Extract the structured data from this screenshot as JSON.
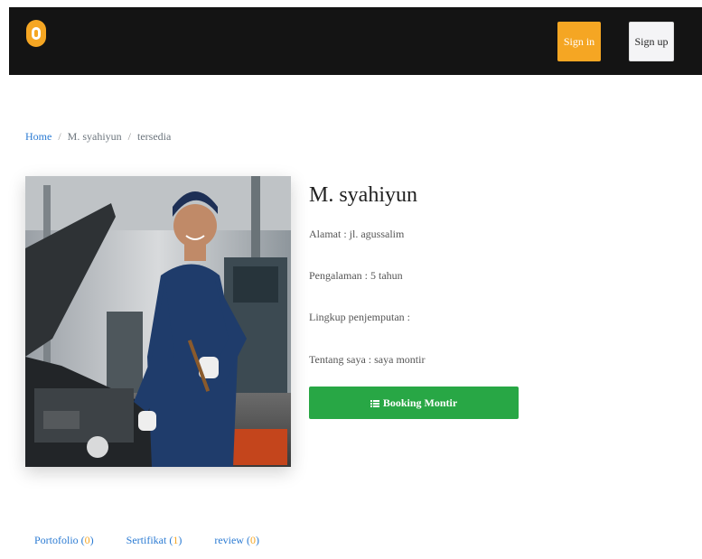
{
  "navbar": {
    "signin_label": "Sign in",
    "signup_label": "Sign up"
  },
  "breadcrumb": {
    "home": "Home",
    "name": "M. syahiyun",
    "status": "tersedia"
  },
  "profile": {
    "name": "M. syahiyun",
    "alamat": "Alamat : jl. agussalim",
    "pengalaman": "Pengalaman : 5 tahun",
    "lingkup": "Lingkup penjemputan :",
    "tentang": "Tentang saya : saya montir",
    "booking_label": "Booking Montir"
  },
  "tabs": [
    {
      "label": "Portofolio",
      "count": "0"
    },
    {
      "label": "Sertifikat",
      "count": "1"
    },
    {
      "label": "review",
      "count": "0"
    }
  ],
  "colors": {
    "brand": "#f5a623",
    "navbar_bg": "#141414",
    "link": "#2b7bd3",
    "success": "#28a745"
  }
}
